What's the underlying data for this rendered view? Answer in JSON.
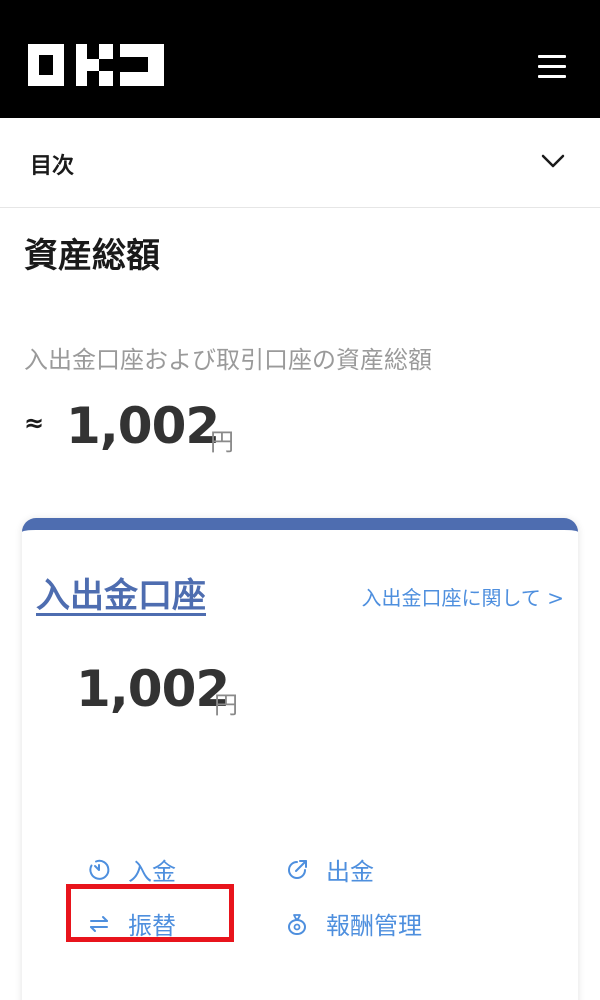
{
  "header": {
    "logo_text": "OKJ",
    "menu_icon": "hamburger-menu-icon"
  },
  "toc": {
    "label": "目次",
    "chevron_icon": "chevron-down-icon"
  },
  "summary": {
    "title": "資産総額",
    "description": "入出金口座および取引口座の資産総額",
    "approx_symbol": "≈",
    "amount": "1,002",
    "unit": "円"
  },
  "account_card": {
    "title": "入出金口座",
    "about_link": "入出金口座に関して >",
    "amount": "1,002",
    "unit": "円",
    "actions": [
      {
        "label": "入金",
        "icon": "deposit-icon"
      },
      {
        "label": "出金",
        "icon": "withdraw-icon"
      },
      {
        "label": "振替",
        "icon": "transfer-icon"
      },
      {
        "label": "報酬管理",
        "icon": "reward-bag-icon"
      }
    ]
  },
  "colors": {
    "header_bg": "#000000",
    "accent_blue": "#4e6db0",
    "link_blue": "#4e8fde",
    "highlight_red": "#e8141c"
  }
}
